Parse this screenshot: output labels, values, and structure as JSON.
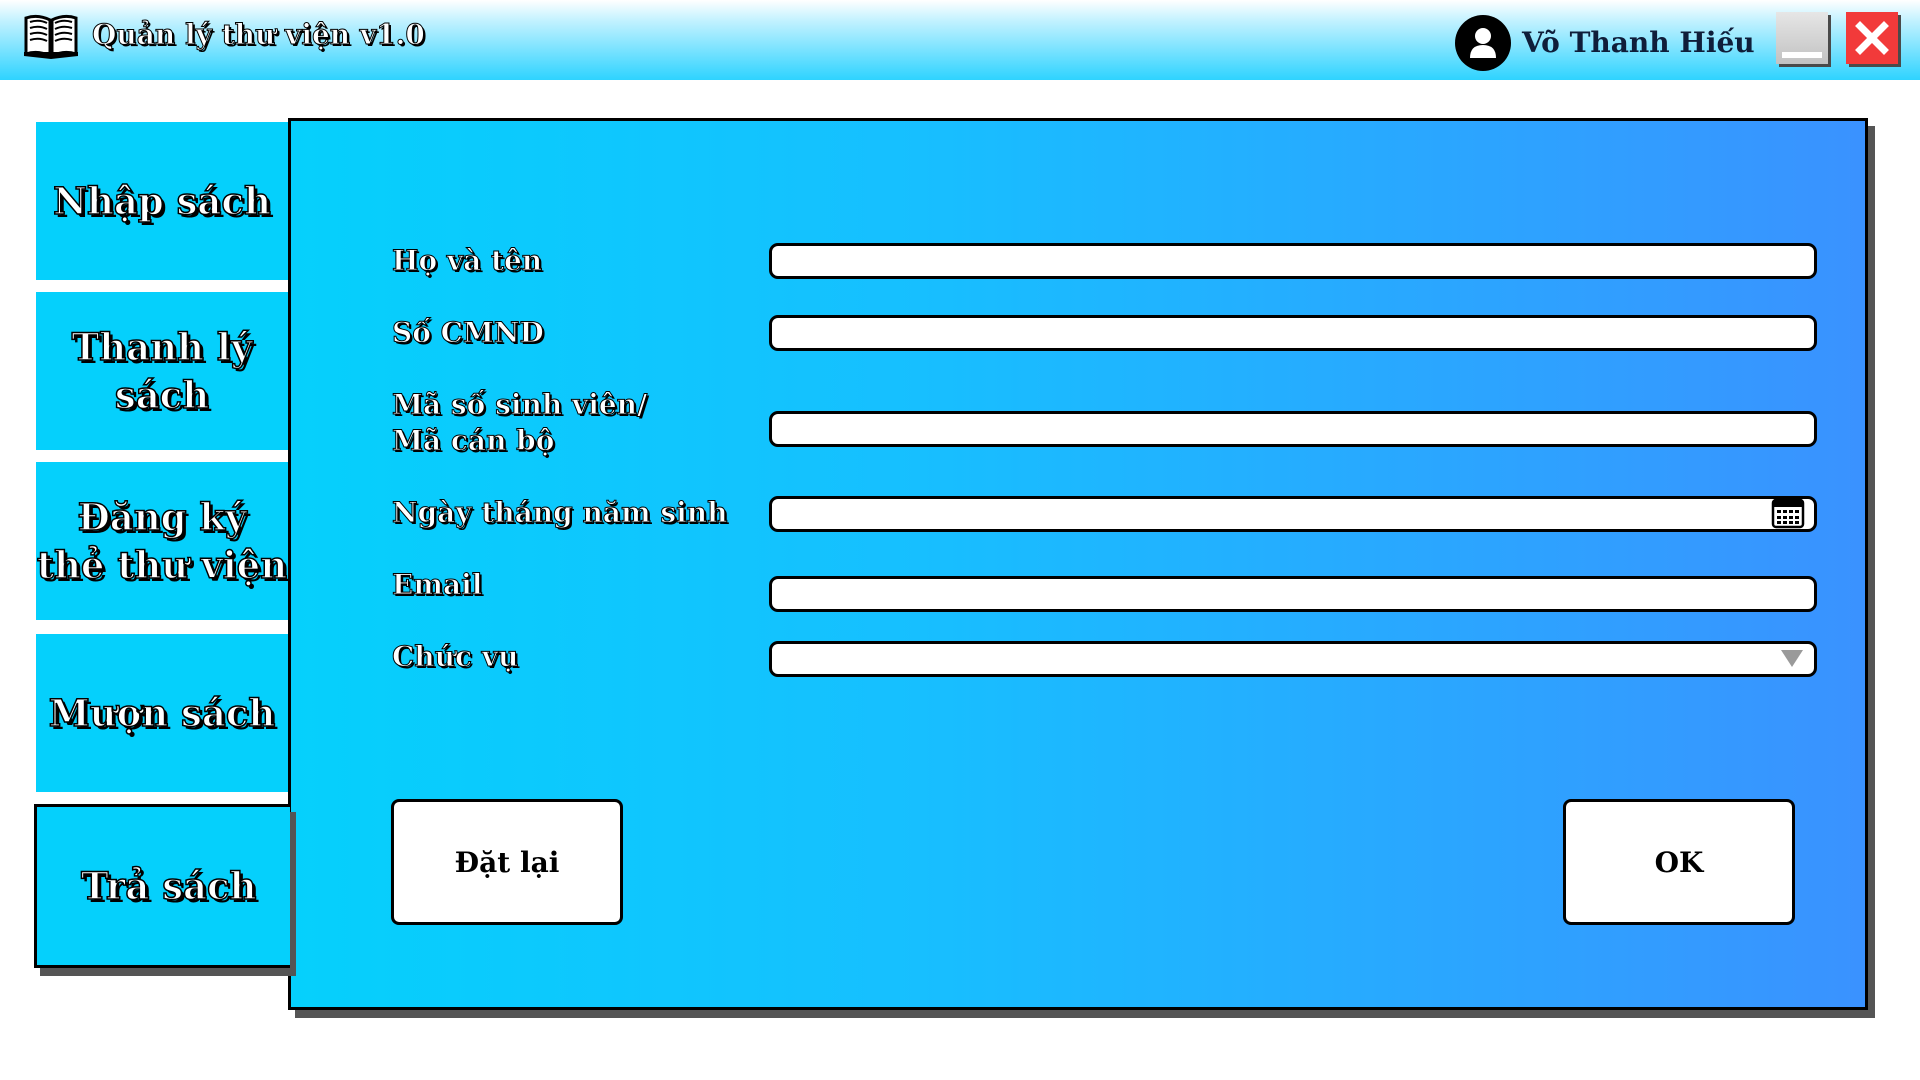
{
  "window": {
    "title": "Quản lý thư viện v1.0",
    "app_icon": "open-book-icon",
    "user_name": "Võ Thanh Hiếu",
    "user_icon": "user-avatar-icon",
    "minimize_icon": "minimize-icon",
    "close_icon": "close-icon"
  },
  "sidebar": {
    "items": [
      {
        "label": "Nhập sách",
        "active": false
      },
      {
        "label": "Thanh lý\nsách",
        "active": false
      },
      {
        "label": "Đăng ký\nthẻ thư viện",
        "active": false
      },
      {
        "label": "Mượn sách",
        "active": false
      },
      {
        "label": "Trả sách",
        "active": true
      }
    ]
  },
  "form": {
    "fields": [
      {
        "label": "Họ và tên",
        "value": ""
      },
      {
        "label": "Số CMND",
        "value": ""
      },
      {
        "label": "Mã số sinh viên/\nMã cán bộ",
        "value": ""
      },
      {
        "label": "Ngày tháng năm sinh",
        "value": "",
        "icon": "calendar-icon"
      },
      {
        "label": "Email",
        "value": ""
      },
      {
        "label": "Chức vụ",
        "value": "",
        "icon": "dropdown-arrow-icon"
      }
    ],
    "reset_label": "Đặt lại",
    "ok_label": "OK"
  },
  "colors": {
    "accent": "#05d0fc",
    "panel_gradient_end": "#3a92ff",
    "close": "#f23a3a"
  }
}
